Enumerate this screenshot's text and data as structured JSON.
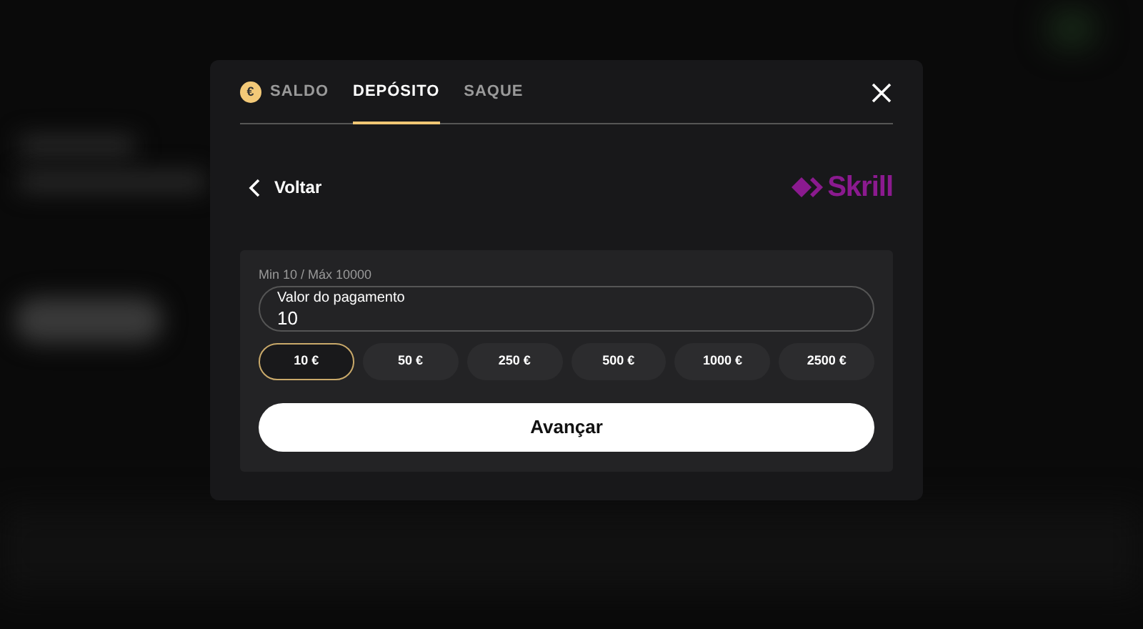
{
  "tabs": [
    {
      "label": "SALDO",
      "icon": "€",
      "selected": false
    },
    {
      "label": "DEPÓSITO",
      "selected": true
    },
    {
      "label": "SAQUE",
      "selected": false
    }
  ],
  "back": {
    "label": "Voltar"
  },
  "provider": {
    "name": "Skrill"
  },
  "amount": {
    "limits": "Min 10 / Máx 10000",
    "label": "Valor do pagamento",
    "value": "10"
  },
  "presets": [
    {
      "label": "10 €",
      "selected": true
    },
    {
      "label": "50 €",
      "selected": false
    },
    {
      "label": "250 €",
      "selected": false
    },
    {
      "label": "500 €",
      "selected": false
    },
    {
      "label": "1000 €",
      "selected": false
    },
    {
      "label": "2500 €",
      "selected": false
    }
  ],
  "submit": {
    "label": "Avançar"
  }
}
